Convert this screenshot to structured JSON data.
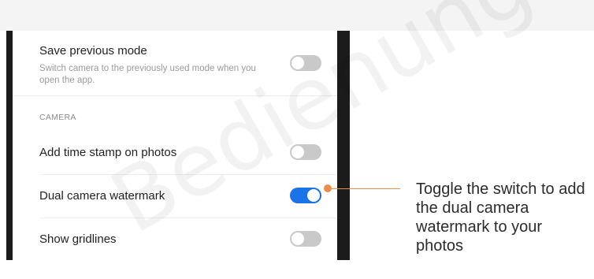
{
  "settings": {
    "save_previous_mode": {
      "title": "Save previous mode",
      "description": "Switch camera to the previously used mode when you open the app.",
      "enabled": false
    },
    "section_header": "CAMERA",
    "rows": [
      {
        "title": "Add time stamp on photos",
        "enabled": false
      },
      {
        "title": "Dual camera watermark",
        "enabled": true
      },
      {
        "title": "Show gridlines",
        "enabled": false
      }
    ]
  },
  "callout": {
    "text": "Toggle the switch to add the dual camera watermark to your photos"
  },
  "watermark": {
    "text": "Bedienungsanleitung"
  },
  "colors": {
    "toggle_on": "#1a73e8",
    "toggle_off": "#c9c9c9",
    "callout": "#f08c4a",
    "frame": "#1b1b1b"
  }
}
